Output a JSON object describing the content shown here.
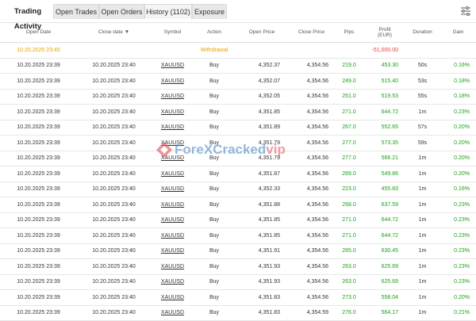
{
  "tabs": {
    "trading_activity": "Trading Activity",
    "open_trades": "Open Trades",
    "open_orders": "Open Orders",
    "history": "History (1102)",
    "exposure": "Exposure"
  },
  "columns": {
    "open_date": "Open Date",
    "close_date": "Close date",
    "sort_arrow": "▼",
    "symbol": "Symbol",
    "action": "Action",
    "open_price": "Open Price",
    "close_price": "Close Price",
    "pips": "Pips",
    "profit": "Profit",
    "profit_unit": "(EUR)",
    "duration": "Duration",
    "gain": "Gain"
  },
  "withdrawal": {
    "open_date": "10.20.2025 23:45",
    "action": "Withdrawal",
    "profit": "-51,000.00"
  },
  "rows": [
    {
      "open": "10.20.2025 23:39",
      "close": "10.20.2025 23:40",
      "symbol": "XAUUSD",
      "action": "Buy",
      "open_price": "4,352.37",
      "close_price": "4,354.56",
      "pips": "219.0",
      "profit": "453.30",
      "duration": "50s",
      "gain": "0.16%"
    },
    {
      "open": "10.20.2025 23:39",
      "close": "10.20.2025 23:40",
      "symbol": "XAUUSD",
      "action": "Buy",
      "open_price": "4,352.07",
      "close_price": "4,354.56",
      "pips": "249.0",
      "profit": "515.40",
      "duration": "53s",
      "gain": "0.18%"
    },
    {
      "open": "10.20.2025 23:39",
      "close": "10.20.2025 23:40",
      "symbol": "XAUUSD",
      "action": "Buy",
      "open_price": "4,352.05",
      "close_price": "4,354.56",
      "pips": "251.0",
      "profit": "519.53",
      "duration": "55s",
      "gain": "0.18%"
    },
    {
      "open": "10.20.2025 23:39",
      "close": "10.20.2025 23:40",
      "symbol": "XAUUSD",
      "action": "Buy",
      "open_price": "4,351.85",
      "close_price": "4,354.56",
      "pips": "271.0",
      "profit": "644.72",
      "duration": "1m",
      "gain": "0.23%"
    },
    {
      "open": "10.20.2025 23:39",
      "close": "10.20.2025 23:40",
      "symbol": "XAUUSD",
      "action": "Buy",
      "open_price": "4,351.89",
      "close_price": "4,354.56",
      "pips": "267.0",
      "profit": "552.65",
      "duration": "57s",
      "gain": "0.20%"
    },
    {
      "open": "10.20.2025 23:39",
      "close": "10.20.2025 23:40",
      "symbol": "XAUUSD",
      "action": "Buy",
      "open_price": "4,351.79",
      "close_price": "4,354.56",
      "pips": "277.0",
      "profit": "573.35",
      "duration": "59s",
      "gain": "0.20%"
    },
    {
      "open": "10.20.2025 23:39",
      "close": "10.20.2025 23:40",
      "symbol": "XAUUSD",
      "action": "Buy",
      "open_price": "4,351.79",
      "close_price": "4,354.56",
      "pips": "277.0",
      "profit": "566.21",
      "duration": "1m",
      "gain": "0.20%"
    },
    {
      "open": "10.20.2025 23:39",
      "close": "10.20.2025 23:40",
      "symbol": "XAUUSD",
      "action": "Buy",
      "open_price": "4,351.87",
      "close_price": "4,354.56",
      "pips": "269.0",
      "profit": "549.86",
      "duration": "1m",
      "gain": "0.20%"
    },
    {
      "open": "10.20.2025 23:39",
      "close": "10.20.2025 23:40",
      "symbol": "XAUUSD",
      "action": "Buy",
      "open_price": "4,352.33",
      "close_price": "4,354.56",
      "pips": "223.0",
      "profit": "455.83",
      "duration": "1m",
      "gain": "0.16%"
    },
    {
      "open": "10.20.2025 23:39",
      "close": "10.20.2025 23:40",
      "symbol": "XAUUSD",
      "action": "Buy",
      "open_price": "4,351.88",
      "close_price": "4,354.56",
      "pips": "268.0",
      "profit": "637.59",
      "duration": "1m",
      "gain": "0.23%"
    },
    {
      "open": "10.20.2025 23:39",
      "close": "10.20.2025 23:40",
      "symbol": "XAUUSD",
      "action": "Buy",
      "open_price": "4,351.85",
      "close_price": "4,354.56",
      "pips": "271.0",
      "profit": "644.72",
      "duration": "1m",
      "gain": "0.23%"
    },
    {
      "open": "10.20.2025 23:39",
      "close": "10.20.2025 23:40",
      "symbol": "XAUUSD",
      "action": "Buy",
      "open_price": "4,351.85",
      "close_price": "4,354.56",
      "pips": "271.0",
      "profit": "644.72",
      "duration": "1m",
      "gain": "0.23%"
    },
    {
      "open": "10.20.2025 23:39",
      "close": "10.20.2025 23:40",
      "symbol": "XAUUSD",
      "action": "Buy",
      "open_price": "4,351.91",
      "close_price": "4,354.56",
      "pips": "265.0",
      "profit": "630.45",
      "duration": "1m",
      "gain": "0.23%"
    },
    {
      "open": "10.20.2025 23:39",
      "close": "10.20.2025 23:40",
      "symbol": "XAUUSD",
      "action": "Buy",
      "open_price": "4,351.93",
      "close_price": "4,354.56",
      "pips": "263.0",
      "profit": "625.69",
      "duration": "1m",
      "gain": "0.23%"
    },
    {
      "open": "10.20.2025 23:39",
      "close": "10.20.2025 23:40",
      "symbol": "XAUUSD",
      "action": "Buy",
      "open_price": "4,351.93",
      "close_price": "4,354.56",
      "pips": "263.0",
      "profit": "625.69",
      "duration": "1m",
      "gain": "0.23%"
    },
    {
      "open": "10.20.2025 23:39",
      "close": "10.20.2025 23:40",
      "symbol": "XAUUSD",
      "action": "Buy",
      "open_price": "4,351.83",
      "close_price": "4,354.56",
      "pips": "273.0",
      "profit": "558.04",
      "duration": "1m",
      "gain": "0.20%"
    },
    {
      "open": "10.20.2025 23:39",
      "close": "10.20.2025 23:40",
      "symbol": "XAUUSD",
      "action": "Buy",
      "open_price": "4,351.83",
      "close_price": "4,354.59",
      "pips": "276.0",
      "profit": "564.17",
      "duration": "1m",
      "gain": "0.21%"
    }
  ],
  "watermark": {
    "part1": "ForeXCracked",
    "part2": "vip"
  },
  "colors": {
    "profit_green": "#1aa01a",
    "withdrawal_orange": "#e8a100",
    "loss_red": "#e34040"
  },
  "icons": {
    "settings": "sliders-icon"
  }
}
